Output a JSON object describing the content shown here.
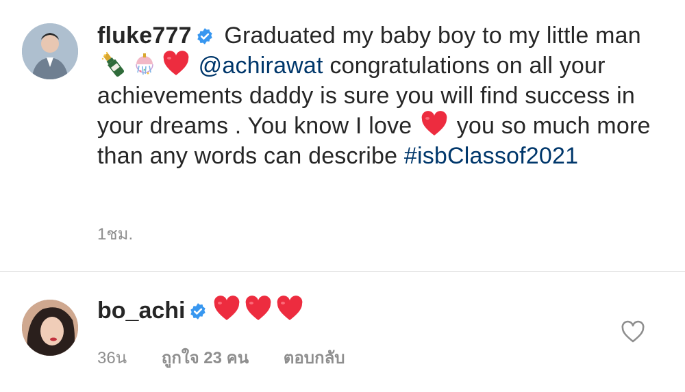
{
  "caption": {
    "username": "fluke777",
    "verified": true,
    "text_part1": "Graduated my baby boy to my little man",
    "mention": "@achirawat",
    "text_part2": "congratulations on all your achievements daddy is sure you will find success in your dreams . You know I love",
    "text_part3": "you so much more than any words can describe",
    "hashtag": "#isbClassof2021",
    "time": "1ชม."
  },
  "comment": {
    "username": "bo_achi",
    "verified": true,
    "time": "36น",
    "likes": "ถูกใจ 23 คน",
    "reply": "ตอบกลับ"
  },
  "icons": {
    "verified": "verified-badge-icon",
    "champagne": "champagne-emoji",
    "confetti": "confetti-ball-emoji",
    "heart": "red-heart-emoji",
    "like": "heart-outline-icon"
  },
  "colors": {
    "text": "#262626",
    "link": "#00376b",
    "secondary": "#8e8e8e",
    "verified_blue": "#3897f0",
    "heart_red": "#ed2c3f"
  }
}
